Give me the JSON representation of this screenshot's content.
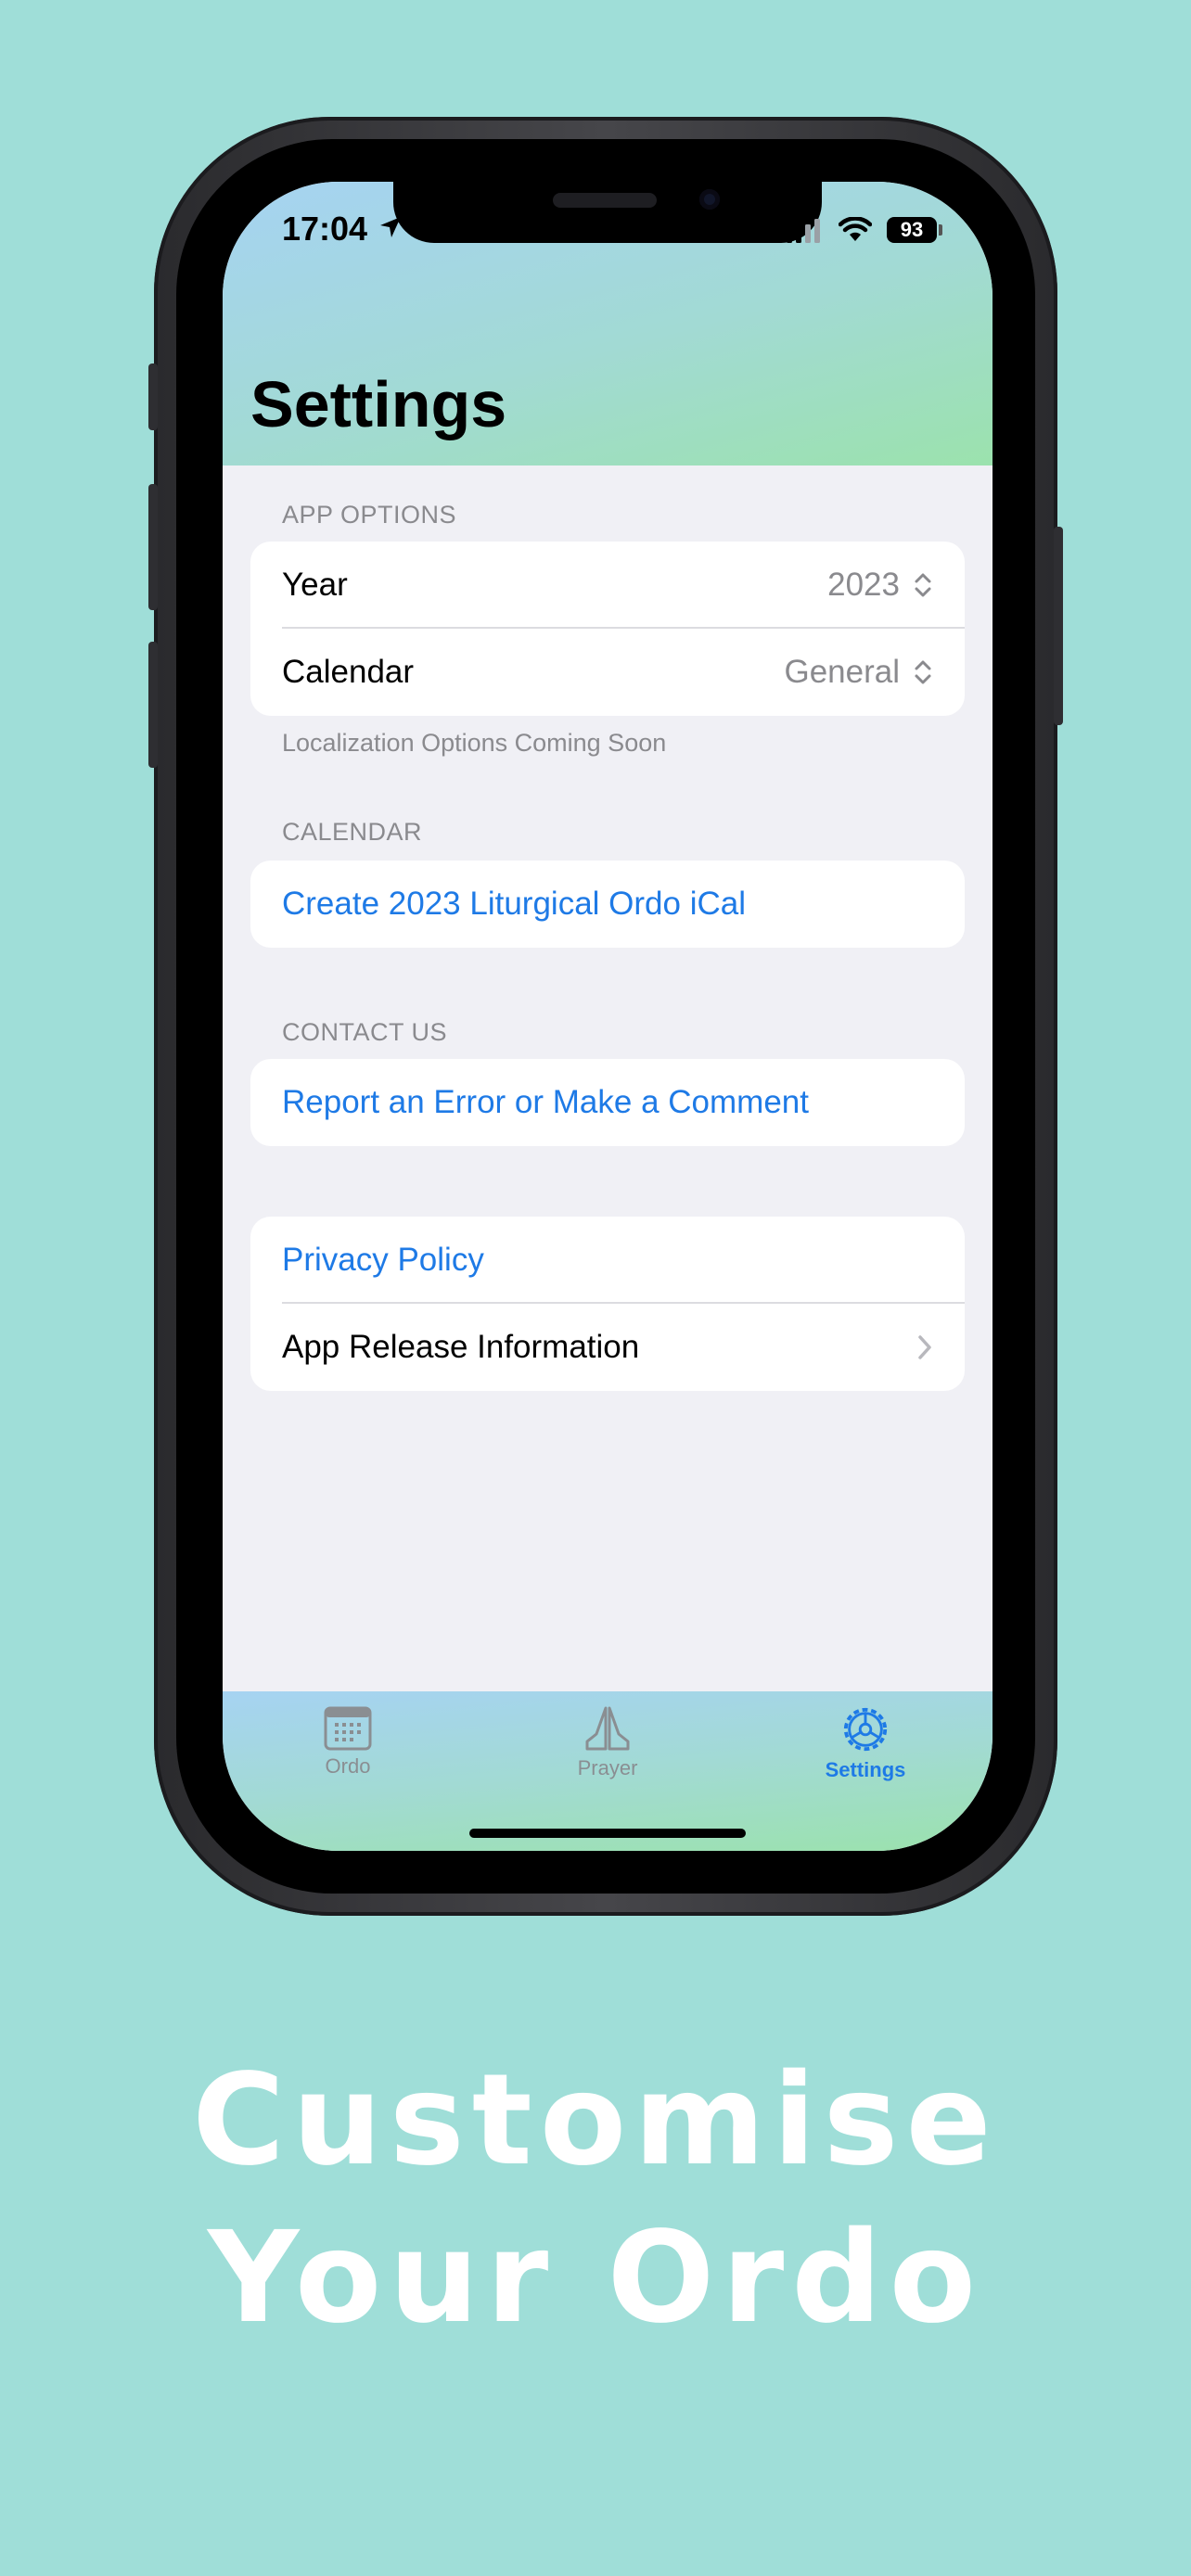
{
  "status_bar": {
    "time": "17:04",
    "battery": "93"
  },
  "page": {
    "title": "Settings"
  },
  "app_options": {
    "header": "APP OPTIONS",
    "rows": [
      {
        "label": "Year",
        "value": "2023"
      },
      {
        "label": "Calendar",
        "value": "General"
      }
    ],
    "footer": "Localization Options Coming Soon"
  },
  "calendar": {
    "header": "CALENDAR",
    "link": "Create 2023 Liturgical Ordo iCal"
  },
  "contact": {
    "header": "CONTACT US",
    "link": "Report an Error or Make a Comment"
  },
  "about": {
    "privacy": "Privacy Policy",
    "release": "App Release Information"
  },
  "tabbar": {
    "tabs": [
      {
        "label": "Ordo",
        "icon": "calendar-icon"
      },
      {
        "label": "Prayer",
        "icon": "praying-hands-icon"
      },
      {
        "label": "Settings",
        "icon": "gear-icon",
        "active": true
      }
    ]
  },
  "tagline": {
    "line1": "Customise",
    "line2": "Your Ordo"
  },
  "colors": {
    "background": "#9fded8",
    "accent": "#1e7ae6",
    "secondary_text": "#8a8a8e"
  }
}
